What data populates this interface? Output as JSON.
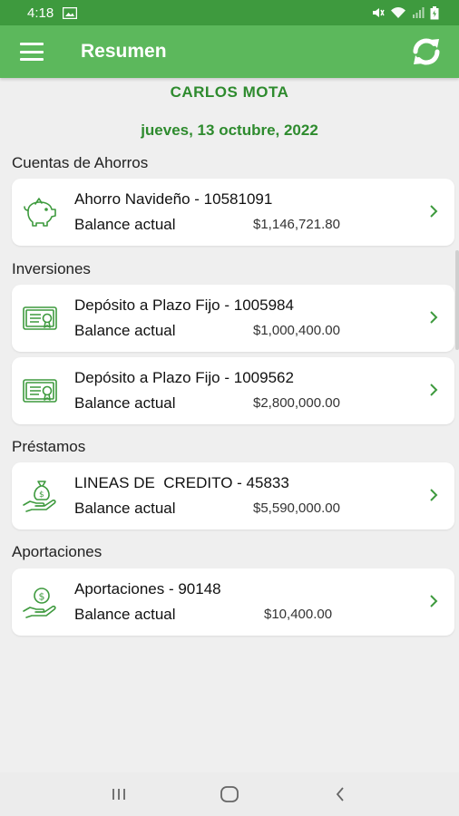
{
  "status_bar": {
    "time": "4:18"
  },
  "app_bar": {
    "title": "Resumen"
  },
  "user": {
    "name": "CARLOS MOTA",
    "date": "jueves, 13 octubre, 2022"
  },
  "colors": {
    "primary": "#5cb85c",
    "status": "#3e9a3e",
    "accent_text": "#2e8b2e"
  },
  "sections": [
    {
      "title": "Cuentas de Ahorros",
      "cards": [
        {
          "icon": "piggy-bank-icon",
          "title": "Ahorro Navideño - 10581091",
          "label": "Balance actual",
          "value": "$1,146,721.80"
        }
      ]
    },
    {
      "title": "Inversiones",
      "cards": [
        {
          "icon": "certificate-icon",
          "title": "Depósito a Plazo Fijo - 1005984",
          "label": "Balance actual",
          "value": "$1,000,400.00"
        },
        {
          "icon": "certificate-icon",
          "title": "Depósito a Plazo Fijo - 1009562",
          "label": "Balance actual",
          "value": "$2,800,000.00"
        }
      ]
    },
    {
      "title": "Préstamos",
      "cards": [
        {
          "icon": "money-bag-hand-icon",
          "title": "LINEAS DE  CREDITO - 45833",
          "label": "Balance actual",
          "value": "$5,590,000.00"
        }
      ]
    },
    {
      "title": "Aportaciones",
      "cards": [
        {
          "icon": "coin-hand-icon",
          "title": "Aportaciones - 90148",
          "label": "Balance actual",
          "value": "$10,400.00"
        }
      ]
    }
  ]
}
